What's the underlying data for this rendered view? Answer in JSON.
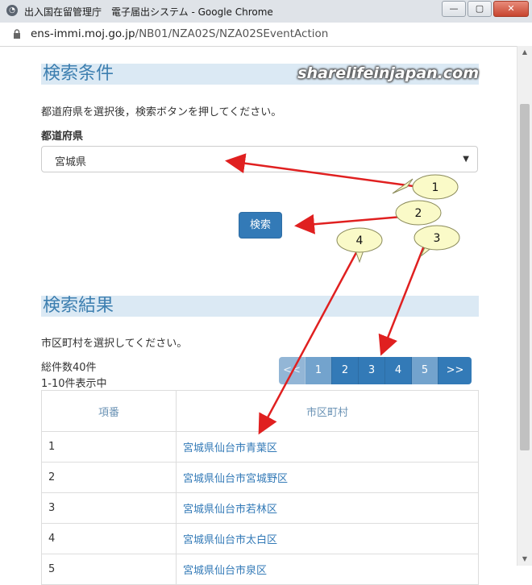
{
  "window": {
    "title": "出入国在留管理庁　電子届出システム - Google Chrome",
    "url_host": "ens-immi.moj.go.jp",
    "url_path": "/NB01/NZA02S/NZA02SEventAction"
  },
  "watermark": "sharelifeinjapan.com",
  "search": {
    "heading": "検索条件",
    "instruction": "都道府県を選択後，検索ボタンを押してください。",
    "field_label": "都道府県",
    "selected_prefecture": "宮城県",
    "button_label": "検索"
  },
  "results": {
    "heading": "検索結果",
    "instruction": "市区町村を選択してください。",
    "total": "総件数40件",
    "range": "1-10件表示中",
    "pagination": [
      "<<",
      "1",
      "2",
      "3",
      "4",
      "5",
      ">>"
    ],
    "columns": [
      "項番",
      "市区町村"
    ],
    "rows": [
      {
        "no": "1",
        "city": "宮城県仙台市青葉区"
      },
      {
        "no": "2",
        "city": "宮城県仙台市宮城野区"
      },
      {
        "no": "3",
        "city": "宮城県仙台市若林区"
      },
      {
        "no": "4",
        "city": "宮城県仙台市太白区"
      },
      {
        "no": "5",
        "city": "宮城県仙台市泉区"
      }
    ]
  },
  "callouts": [
    "1",
    "2",
    "3",
    "4"
  ],
  "colors": {
    "accent": "#337ab7",
    "heading_bg": "#dbe9f4",
    "arrow": "#e02020",
    "callout": "#fafac8"
  }
}
